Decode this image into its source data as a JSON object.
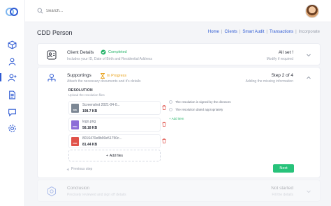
{
  "search": {
    "placeholder": "Search..."
  },
  "page": {
    "title": "CDD Person"
  },
  "breadcrumb": [
    "Home",
    "Clients",
    "Smart Audit",
    "Transactions",
    "Incorporate"
  ],
  "steps": [
    {
      "title": "Client Details",
      "badge": "Completed",
      "description": "Includes your ID, Date of Birth and Residential Address",
      "status": "All set !",
      "sub": "Modify if required"
    },
    {
      "title": "Supportings",
      "badge": "In Progress",
      "description": "Attach the necessary documents and it's details",
      "status": "Step 2 of 4",
      "sub": "Adding the missing information",
      "section_label": "RESOLUTION",
      "section_desc": "Upload the resolution files",
      "files": [
        {
          "name": "Screenshot 2021-04-0...",
          "size": "198.7 KB",
          "type": "IMG",
          "color": "#7c8794"
        },
        {
          "name": "logo.png",
          "size": "58.18 KB",
          "type": "PNG",
          "color": "#8d6ed8"
        },
        {
          "name": "8016470e8b90e51750c...",
          "size": "81.44 KB",
          "type": "PDF",
          "color": "#e0524a"
        }
      ],
      "add_files": "Add files",
      "checklist": [
        "The resolution is signed by the directors",
        "The resolution dated appropriately"
      ],
      "add_item": "Add item",
      "prev": "Previous step",
      "next": "Next"
    },
    {
      "title": "Conclusion",
      "description": "Precisely reviewed and sign off details",
      "status": "Not started",
      "sub": "Fill the details"
    }
  ],
  "colors": {
    "accent": "#2f5bd3",
    "success": "#27c27a",
    "warning": "#e9a21b"
  }
}
